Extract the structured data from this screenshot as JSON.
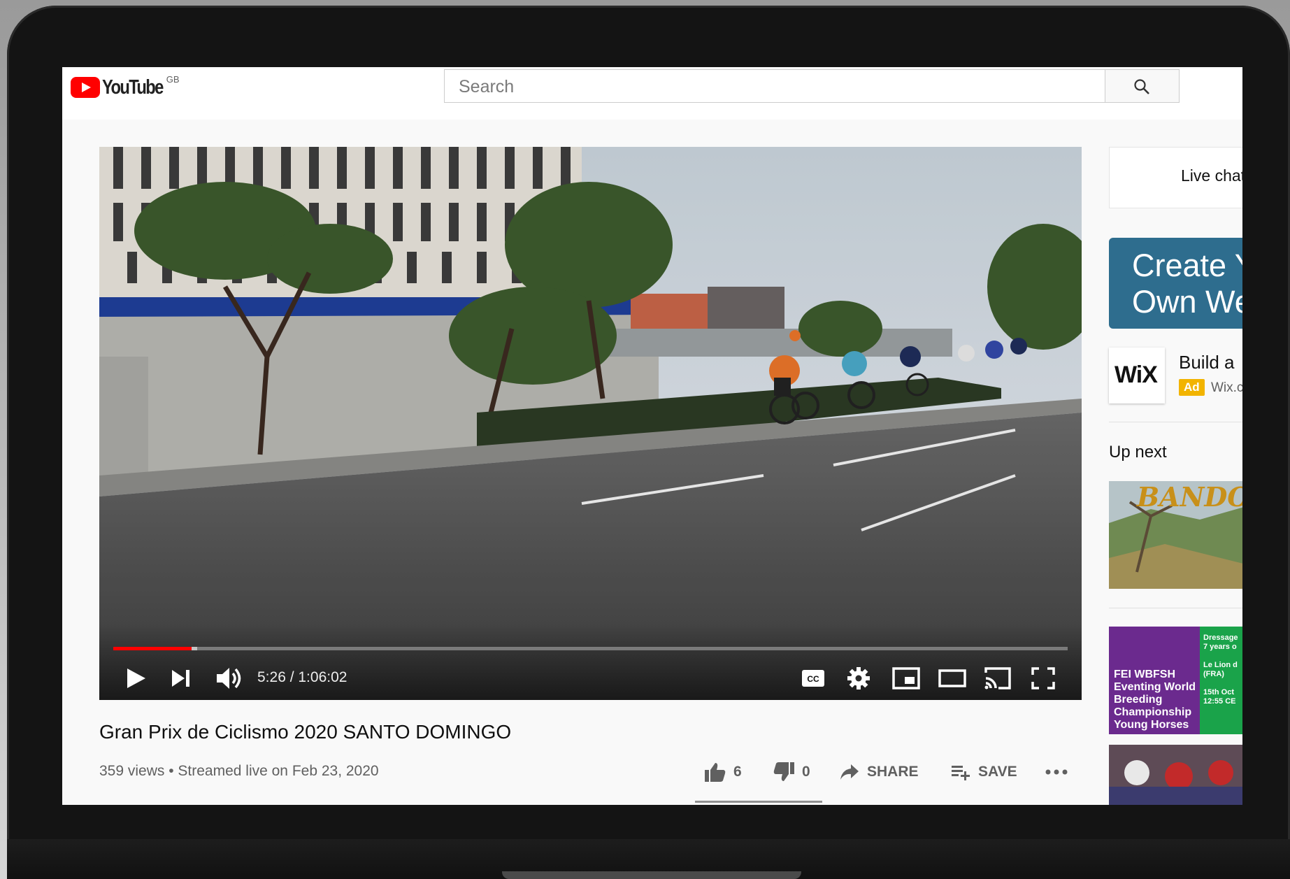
{
  "header": {
    "logo_text": "YouTube",
    "country_code": "GB",
    "search_placeholder": "Search"
  },
  "player": {
    "current_time": "5:26",
    "duration": "1:06:02",
    "time_display": "5:26 / 1:06:02",
    "progress_fraction": 0.082
  },
  "video": {
    "title": "Gran Prix de Ciclismo 2020 SANTO DOMINGO",
    "meta": "359 views • Streamed live on Feb 23, 2020",
    "likes": "6",
    "dislikes": "0",
    "share_label": "SHARE",
    "save_label": "SAVE"
  },
  "sidebar": {
    "live_chat": "Live chat",
    "ad_banner_line1": "Create Y",
    "ad_banner_line2": "Own We",
    "ad_logo": "WiX",
    "ad_title": "Build a",
    "ad_badge": "Ad",
    "ad_domain": "Wix.c",
    "up_next": "Up next",
    "thumb1_text": "BANDOLE",
    "thumb2_lines": [
      "FEI WBFSH",
      "Eventing World",
      "Breeding",
      "Championship",
      "Young Horses"
    ],
    "thumb2_side_lines": [
      "Dressage",
      "7 years o",
      "",
      "Le Lion d",
      "(FRA)",
      "",
      "15th Oct",
      "12:55 CE"
    ]
  },
  "colors": {
    "brand_red": "#ff0000",
    "ad_banner": "#2e6d8e",
    "ad_badge": "#f2b400"
  }
}
